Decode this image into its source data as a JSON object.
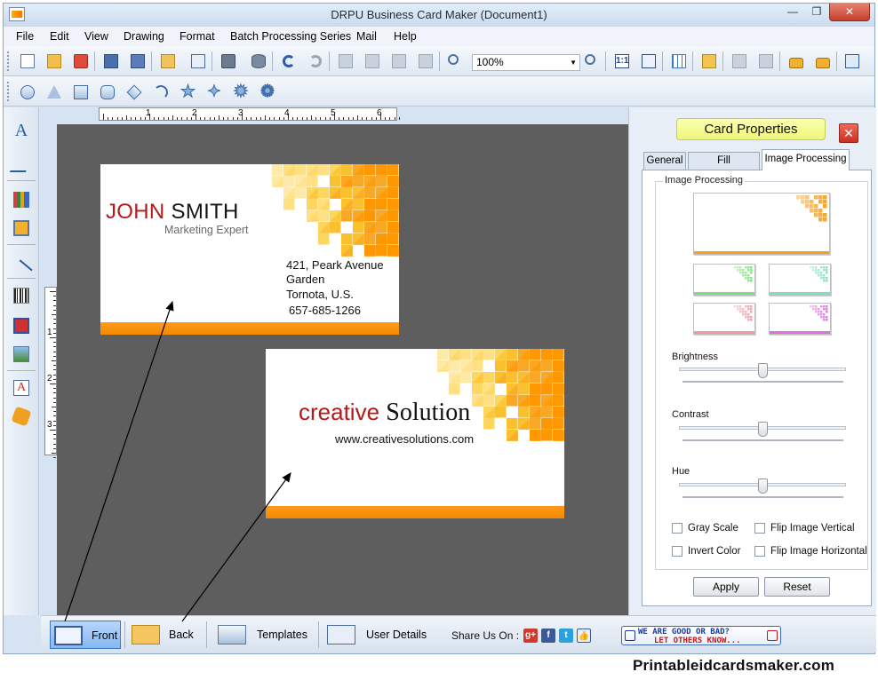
{
  "window": {
    "title": "DRPU Business Card Maker (Document1)",
    "min_glyph": "—",
    "max_glyph": "❐",
    "close_glyph": "✕"
  },
  "menu": [
    "File",
    "Edit",
    "View",
    "Drawing",
    "Format",
    "Batch Processing Series",
    "Mail",
    "Help"
  ],
  "toolbar": {
    "zoom_value": "100%",
    "zoom_arrow": "▼",
    "one_to_one": "1:1",
    "icons": [
      "new-icon",
      "open-icon",
      "close-doc-icon",
      "save-icon",
      "save-as-icon",
      "export-icon",
      "export-pdf-icon",
      "print-icon",
      "database-icon",
      "undo-icon",
      "redo-icon",
      "copy-icon",
      "cut-icon",
      "paste-icon",
      "delete-icon",
      "zoom-in-icon",
      "zoom-out-icon",
      "actual-size-icon",
      "fit-window-icon",
      "grid-icon",
      "send-mail-icon",
      "bring-front-icon",
      "send-back-icon",
      "lock-icon",
      "unlock-icon",
      "view-icon"
    ]
  },
  "shapes": {
    "star_glyph": "★",
    "star4_glyph": "✦",
    "burst_glyph": "✹",
    "cloud_glyph": "✺"
  },
  "left_tools": {
    "text_glyph": "A",
    "watermark_glyph": "A"
  },
  "ruler": {
    "h_numbers": [
      "1",
      "2",
      "3",
      "4",
      "5",
      "6"
    ],
    "v_numbers": [
      "1",
      "2",
      "3"
    ]
  },
  "card_front": {
    "first_name": "JOHN",
    "last_name": "SMITH",
    "title": "Marketing Expert",
    "address_line1": "421, Peark Avenue",
    "address_line2": "Garden",
    "address_line3": "Tornota, U.S.",
    "phone": "657-685-1266"
  },
  "card_back": {
    "company_part1": "creative",
    "company_part2": "Solution",
    "website": "www.creativesolutions.com"
  },
  "colors": {
    "accent_orange": "#f58a00",
    "name_red": "#b51a1a",
    "canvas_gray": "#5e5e5e",
    "mosaic": [
      "#fde9a8",
      "#fcd65e",
      "#fbc02d",
      "#f9a825",
      "#ff9800",
      "#fff3cf",
      "#ffe082"
    ]
  },
  "panel": {
    "title": "Card Properties",
    "close_glyph": "✕",
    "tabs": [
      "General",
      "Fill Background",
      "Image Processing"
    ],
    "group_label": "Image Processing",
    "brightness_label": "Brightness",
    "contrast_label": "Contrast",
    "hue_label": "Hue",
    "brightness_value": 0.5,
    "contrast_value": 0.5,
    "hue_value": 0.5,
    "gray_scale": "Gray Scale",
    "flip_vertical": "Flip Image Vertical",
    "invert_color": "Invert Color",
    "flip_horizontal": "Flip Image Horizontal",
    "apply": "Apply",
    "reset": "Reset",
    "thumb_tints": [
      "#f5a020",
      "#7de07a",
      "#7de0c0",
      "#f09aa8",
      "#e070e0"
    ]
  },
  "bottom": {
    "front": "Front",
    "back": "Back",
    "templates": "Templates",
    "user_details": "User Details",
    "share_label": "Share Us On :",
    "gplus": "g+",
    "fb": "f",
    "tw": "t",
    "like": "👍",
    "feedback_line1": "WE ARE GOOD OR BAD?",
    "feedback_line2": "LET OTHERS KNOW..."
  },
  "brand": "Printableidcardsmaker.com"
}
